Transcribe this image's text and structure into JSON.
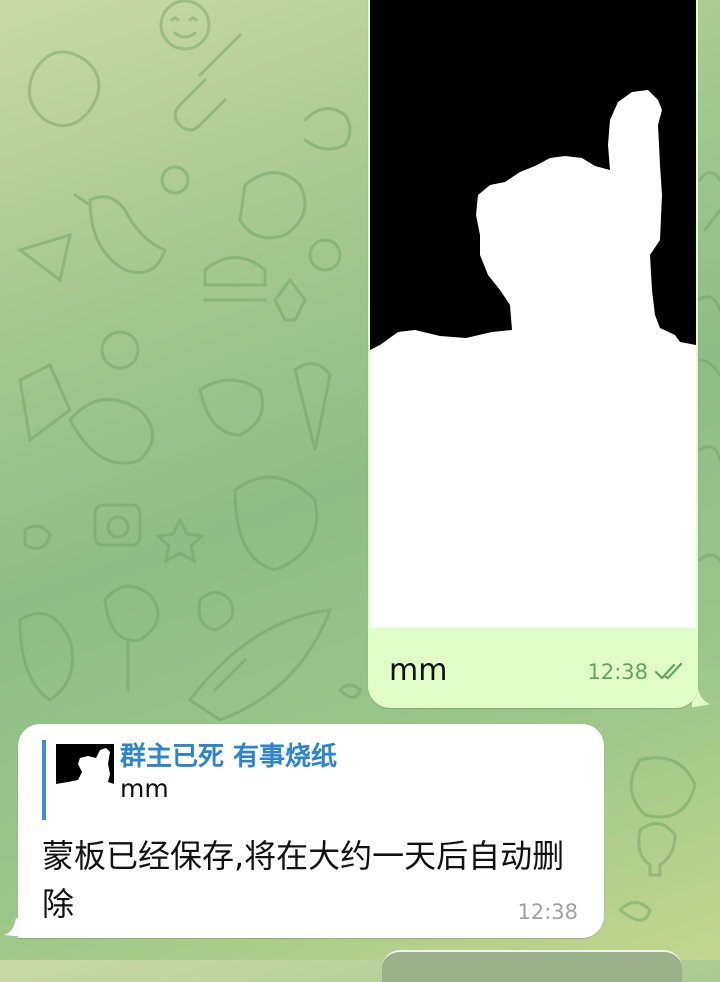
{
  "outgoing_message": {
    "caption": "mm",
    "time": "12:38",
    "status_icon": "double-check-icon",
    "image": "mask-image"
  },
  "incoming_message": {
    "reply": {
      "sender": "群主已死 有事烧纸",
      "text": "mm",
      "thumbnail": "mask-thumbnail"
    },
    "text": "蒙板已经保存,将在大约一天后自动删除",
    "time": "12:38"
  },
  "colors": {
    "outgoing_bubble": "#e1fec6",
    "incoming_bubble": "#ffffff",
    "reply_accent": "#2a84cf",
    "read_check": "#5fa75b"
  }
}
